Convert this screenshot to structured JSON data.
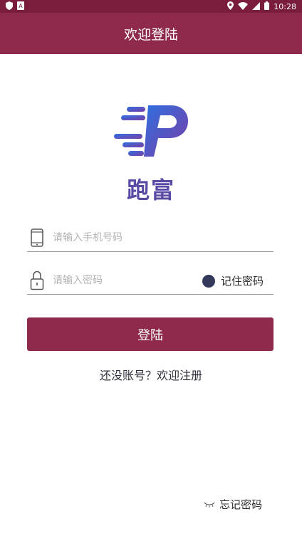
{
  "status_bar": {
    "time": "10:28"
  },
  "app_bar": {
    "title": "欢迎登陆"
  },
  "logo": {
    "text": "跑富"
  },
  "phone": {
    "placeholder": "请输入手机号码"
  },
  "password": {
    "placeholder": "请输入密码"
  },
  "remember": {
    "label": "记住密码"
  },
  "login": {
    "label": "登陆"
  },
  "register": {
    "label": "还没账号？欢迎注册"
  },
  "forgot": {
    "label": "忘记密码"
  },
  "colors": {
    "primary": "#8f2a4c",
    "status_bar": "#7a1c3c",
    "logo_blue": "#2f6fe0",
    "logo_purple": "#7a3ea6"
  },
  "icons": {
    "status_left": [
      "shield-icon",
      "sim-icon"
    ],
    "status_right": [
      "location-icon",
      "wifi-icon",
      "signal-icon",
      "battery-icon"
    ],
    "phone_field": "phone-icon",
    "password_field": "lock-icon",
    "forgot": "eye-closed-icon"
  }
}
